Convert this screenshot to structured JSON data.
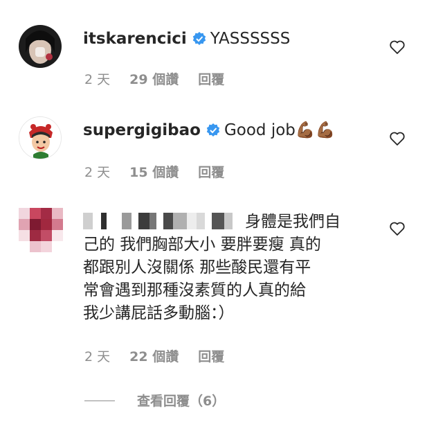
{
  "comments": [
    {
      "username": "itskarencici",
      "text": "YASSSSSS",
      "age": "2 天",
      "likes": "29 個讚",
      "reply": "回覆"
    },
    {
      "username": "supergigibao",
      "text": "Good job💪🏾💪🏾",
      "age": "2 天",
      "likes": "15 個讚",
      "reply": "回覆"
    },
    {
      "text_line1": "身體是我們自",
      "text_line2": "己的 我們胸部大小 要胖要瘦 真的",
      "text_line3": "都跟別人沒關係 那些酸民還有平",
      "text_line4": "常會遇到那種沒素質的人真的給",
      "text_line5": "我少講屁話多動腦：）",
      "age": "2 天",
      "likes": "22 個讚",
      "reply": "回覆"
    }
  ],
  "view_replies": "查看回覆（6）",
  "colors": {
    "text": "#262626",
    "secondary": "#8e8e8e",
    "verified": "#3897f0"
  }
}
